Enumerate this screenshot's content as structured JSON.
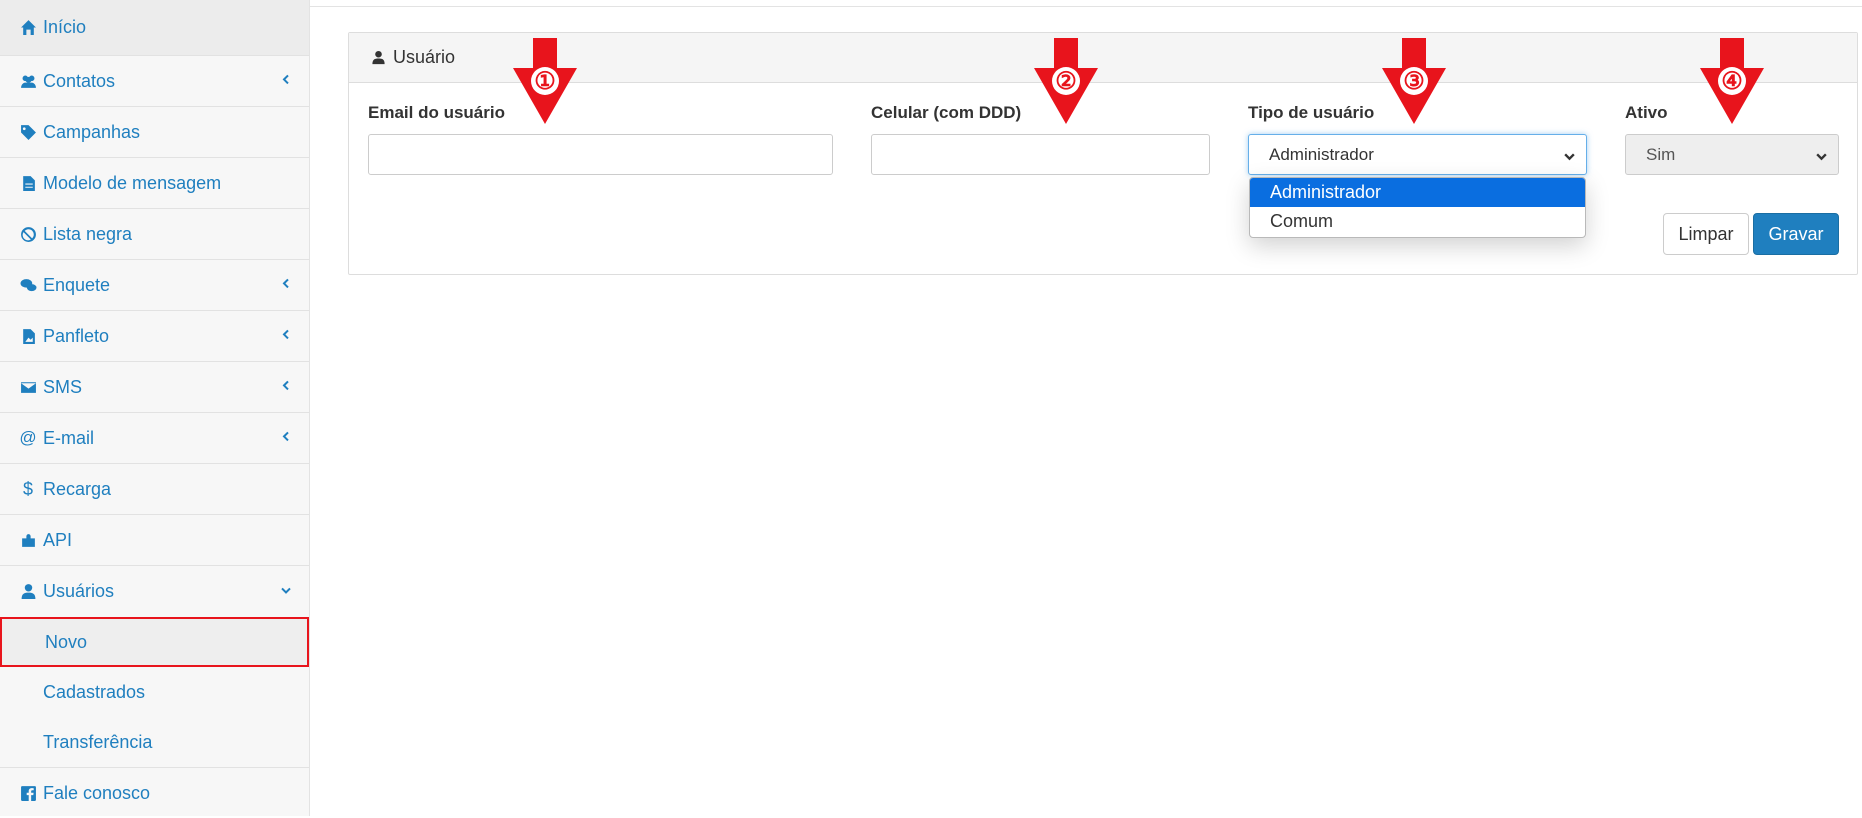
{
  "sidebar": {
    "items": [
      {
        "label": "Início",
        "icon": "home-icon",
        "chevron": false
      },
      {
        "label": "Contatos",
        "icon": "users-icon",
        "chevron": true
      },
      {
        "label": "Campanhas",
        "icon": "tag-icon",
        "chevron": false
      },
      {
        "label": "Modelo de mensagem",
        "icon": "file-icon",
        "chevron": false
      },
      {
        "label": "Lista negra",
        "icon": "ban-icon",
        "chevron": false
      },
      {
        "label": "Enquete",
        "icon": "comments-icon",
        "chevron": true
      },
      {
        "label": "Panfleto",
        "icon": "image-file-icon",
        "chevron": true
      },
      {
        "label": "SMS",
        "icon": "envelope-icon",
        "chevron": true
      },
      {
        "label": "E-mail",
        "icon": "at-icon",
        "chevron": true
      },
      {
        "label": "Recarga",
        "icon": "dollar-icon",
        "chevron": false
      },
      {
        "label": "API",
        "icon": "puzzle-icon",
        "chevron": false
      },
      {
        "label": "Usuários",
        "icon": "user-icon",
        "chevron": "down"
      }
    ],
    "subitems": [
      {
        "label": "Novo",
        "active": true
      },
      {
        "label": "Cadastrados",
        "active": false
      },
      {
        "label": "Transferência",
        "active": false
      }
    ],
    "footer_item": {
      "label": "Fale conosco",
      "icon": "facebook-icon"
    }
  },
  "panel": {
    "title": "Usuário",
    "fields": {
      "email": {
        "label": "Email do usuário",
        "value": ""
      },
      "celular": {
        "label": "Celular (com DDD)",
        "value": ""
      },
      "tipo": {
        "label": "Tipo de usuário",
        "value": "Administrador",
        "options": [
          "Administrador",
          "Comum"
        ]
      },
      "ativo": {
        "label": "Ativo",
        "value": "Sim"
      }
    },
    "buttons": {
      "limpar": "Limpar",
      "gravar": "Gravar"
    }
  },
  "annotations": [
    "①",
    "②",
    "③",
    "④"
  ],
  "colors": {
    "link": "#1f7fbf",
    "highlight_border": "#e8141c",
    "arrow": "#e8141c",
    "option_selected": "#0a6ee0",
    "primary_button": "#1f7fbf"
  }
}
